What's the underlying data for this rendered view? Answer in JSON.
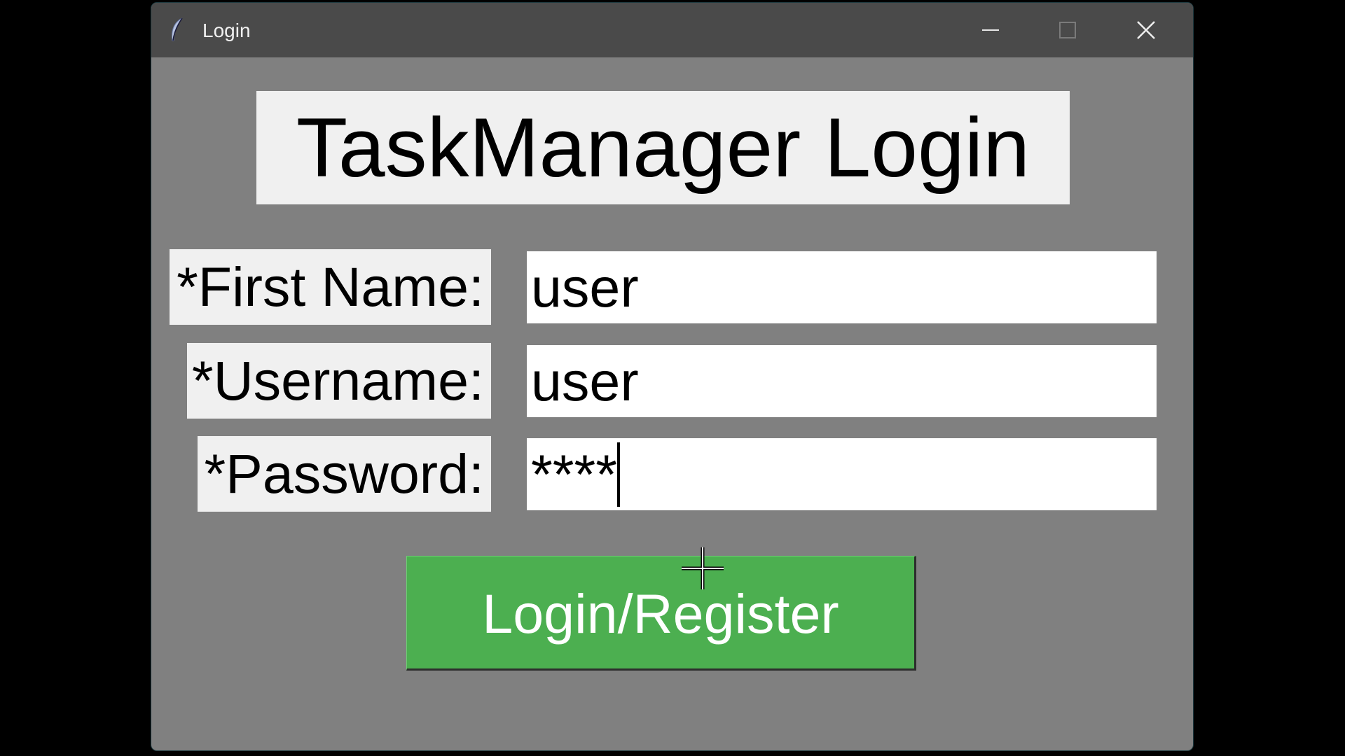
{
  "window": {
    "title": "Login",
    "app_icon": "feather-icon",
    "controls": {
      "minimize_icon": "minimize-icon",
      "maximize_icon": "maximize-icon",
      "close_icon": "close-icon"
    }
  },
  "form": {
    "heading": "TaskManager Login",
    "first_name_label": "*First Name:",
    "first_name_value": "user",
    "username_label": "*Username:",
    "username_value": "user",
    "password_label": "*Password:",
    "password_value": "****",
    "submit_label": "Login/Register"
  },
  "colors": {
    "window_bg": "#808080",
    "titlebar_bg": "#4a4a4a",
    "label_bg": "#f0f0f0",
    "button_bg": "#4caf50",
    "button_text": "#ffffff"
  }
}
